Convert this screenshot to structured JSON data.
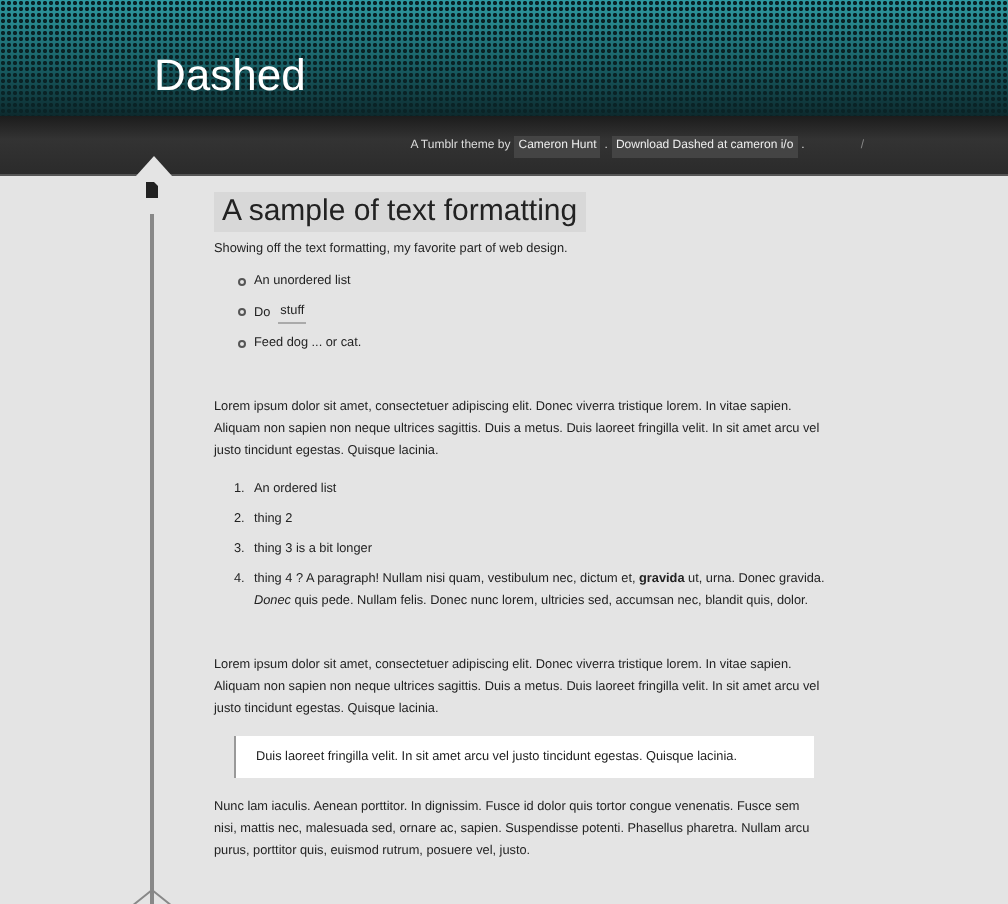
{
  "header": {
    "title": "Dashed"
  },
  "credits": [
    {
      "kind": "text",
      "text": "A Tumblr theme by"
    },
    {
      "kind": "link",
      "text": "Cameron Hunt"
    },
    {
      "kind": "text",
      "text": "."
    },
    {
      "kind": "link",
      "text": "Download Dashed at cameron i/o"
    },
    {
      "kind": "text",
      "text": "."
    },
    {
      "kind": "separator",
      "text": "/"
    }
  ],
  "post": {
    "title": "A sample of text formatting",
    "intro": "Showing off the text formatting, my favorite part of web design.",
    "blocks": [
      {
        "kind": "unordered_list",
        "items": [
          {
            "text": "An unordered list"
          },
          {
            "text": "Do",
            "code": "stuff"
          },
          {
            "text": "Feed dog ... or cat."
          }
        ]
      },
      {
        "kind": "paragraph",
        "text": "Lorem ipsum dolor sit amet, consectetuer adipiscing elit. Donec viverra tristique lorem. In vitae sapien. Aliquam non sapien non neque ultrices sagittis. Duis a metus. Duis laoreet fringilla velit. In sit amet arcu vel justo tincidunt egestas. Quisque lacinia."
      },
      {
        "kind": "ordered_list",
        "items": [
          {
            "number": "1.",
            "text": "An ordered list"
          },
          {
            "number": "2.",
            "text": "thing 2"
          },
          {
            "number": "3.",
            "text": "thing 3 is a bit longer"
          },
          {
            "number": "4.",
            "text": "thing 4 ? A paragraph! Nullam nisi quam, vestibulum nec, dictum et, **gravida** ut, urna. Donec gravida. *Donec* quis pede. Nullam felis. Donec nunc lorem, ultricies sed, accumsan nec, blandit quis, dolor."
          }
        ]
      },
      {
        "kind": "paragraph",
        "text": "Lorem ipsum dolor sit amet, consectetuer adipiscing elit. Donec viverra tristique lorem. In vitae sapien. Aliquam non sapien non neque ultrices sagittis. Duis a metus. Duis laoreet fringilla velit. In sit amet arcu vel justo tincidunt egestas. Quisque lacinia."
      },
      {
        "kind": "blockquote",
        "text": "Duis laoreet fringilla velit. In sit amet arcu vel justo tincidunt egestas. Quisque lacinia."
      },
      {
        "kind": "paragraph",
        "text": "Nunc lam iaculis. Aenean porttitor. In dignissim. Fusce id dolor quis tortor congue venenatis. Fusce sem nisi, mattis nec, malesuada sed, ornare ac, sapien. Suspendisse potenti. Phasellus pharetra. Nullam arcu purus, porttitor quis, euismod rutrum, posuere vel, justo."
      }
    ]
  }
}
